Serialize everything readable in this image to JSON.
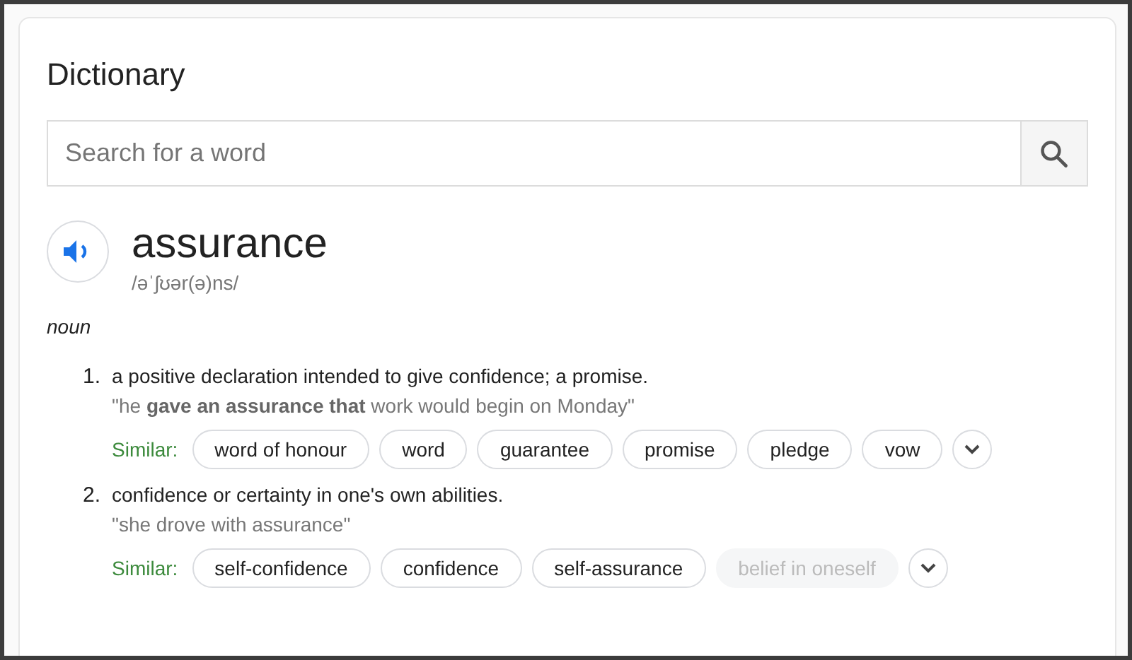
{
  "title": "Dictionary",
  "search": {
    "placeholder": "Search for a word"
  },
  "entry": {
    "word": "assurance",
    "phonetic": "/əˈʃʊər(ə)ns/",
    "part_of_speech": "noun",
    "senses": [
      {
        "number": "1.",
        "definition": "a positive declaration intended to give confidence; a promise.",
        "example": "\"he **gave an assurance that** work would begin on Monday\"",
        "similar_label": "Similar:",
        "similar": [
          {
            "text": "word of honour",
            "disabled": false
          },
          {
            "text": "word",
            "disabled": false
          },
          {
            "text": "guarantee",
            "disabled": false
          },
          {
            "text": "promise",
            "disabled": false
          },
          {
            "text": "pledge",
            "disabled": false
          },
          {
            "text": "vow",
            "disabled": false
          }
        ]
      },
      {
        "number": "2.",
        "definition": "confidence or certainty in one's own abilities.",
        "example": "\"she drove with assurance\"",
        "similar_label": "Similar:",
        "similar": [
          {
            "text": "self-confidence",
            "disabled": false
          },
          {
            "text": "confidence",
            "disabled": false
          },
          {
            "text": "self-assurance",
            "disabled": false
          },
          {
            "text": "belief in oneself",
            "disabled": true
          }
        ]
      }
    ]
  }
}
